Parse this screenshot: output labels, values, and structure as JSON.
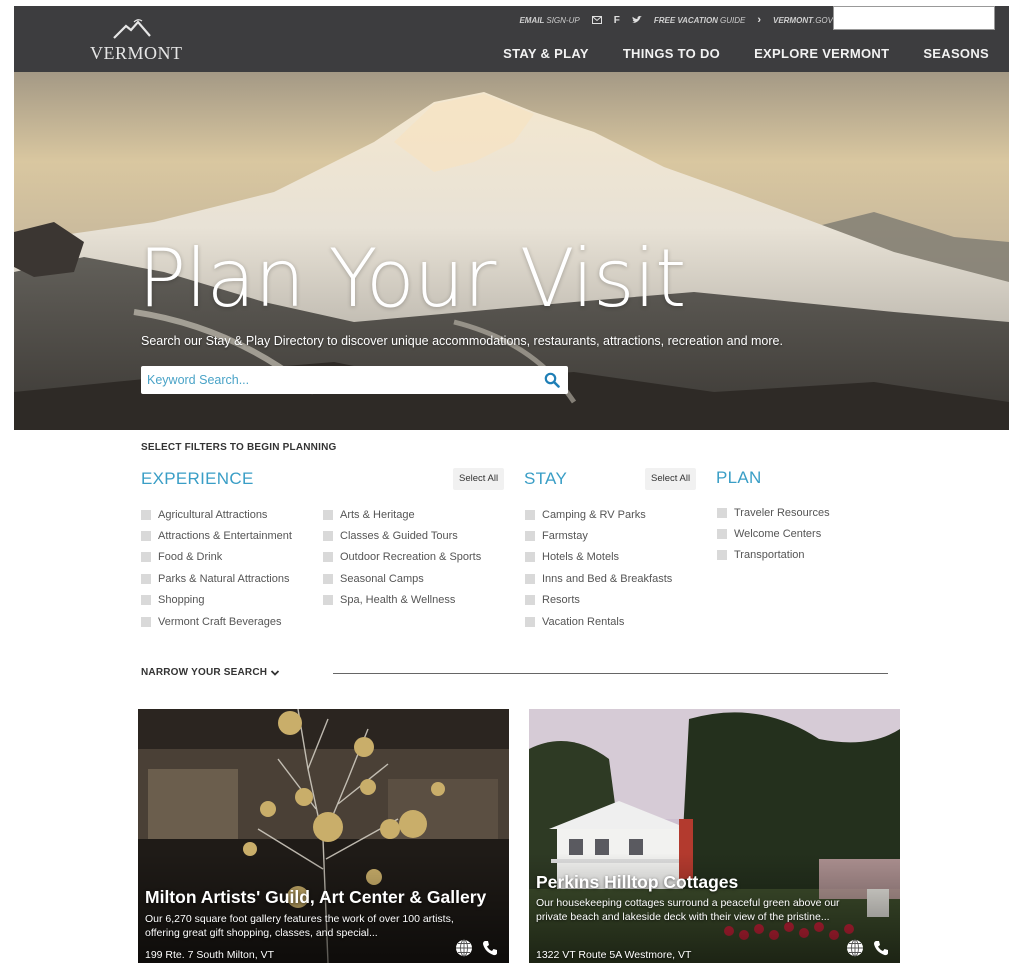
{
  "header": {
    "logo_text": "VERMONT",
    "utility": {
      "email_signup_bold": "EMAIL",
      "email_signup_thin": "SIGN-UP",
      "vacation_guide_bold": "FREE VACATION",
      "vacation_guide_thin": "GUIDE",
      "vermont_gov_bold": "VERMONT",
      "vermont_gov_thin": ".GOV"
    },
    "nav": [
      "STAY & PLAY",
      "THINGS TO DO",
      "EXPLORE VERMONT",
      "SEASONS"
    ]
  },
  "hero": {
    "title": "Plan Your Visit",
    "subtitle": "Search our Stay & Play Directory to discover unique accommodations, restaurants, attractions, recreation and more.",
    "search_placeholder": "Keyword Search..."
  },
  "filters": {
    "heading": "SELECT FILTERS TO BEGIN PLANNING",
    "select_all_label": "Select All",
    "experience": {
      "title": "EXPERIENCE",
      "col1": [
        "Agricultural Attractions",
        "Attractions & Entertainment",
        "Food & Drink",
        "Parks & Natural Attractions",
        "Shopping",
        "Vermont Craft Beverages"
      ],
      "col2": [
        "Arts & Heritage",
        "Classes & Guided Tours",
        "Outdoor Recreation & Sports",
        "Seasonal Camps",
        "Spa, Health & Wellness"
      ]
    },
    "stay": {
      "title": "STAY",
      "items": [
        "Camping & RV Parks",
        "Farmstay",
        "Hotels & Motels",
        "Inns and Bed & Breakfasts",
        "Resorts",
        "Vacation Rentals"
      ]
    },
    "plan": {
      "title": "PLAN",
      "items": [
        "Traveler Resources",
        "Welcome Centers",
        "Transportation"
      ]
    },
    "narrow_label": "NARROW YOUR SEARCH"
  },
  "cards": [
    {
      "title": "Milton Artists' Guild, Art Center & Gallery",
      "description": "Our 6,270 square foot gallery features the work of over 100 artists, offering great gift shopping, classes, and special...",
      "address": "199 Rte. 7 South Milton, VT"
    },
    {
      "title": "Perkins Hilltop Cottages",
      "description": "Our housekeeping cottages surround a peaceful green above our private beach and lakeside deck with their view of the pristine...",
      "address": "1322 VT Route 5A Westmore, VT"
    }
  ],
  "colors": {
    "header_bg": "#3d3d3f",
    "accent_blue": "#3a9ec6",
    "checkbox_gray": "#d9d9d9"
  }
}
